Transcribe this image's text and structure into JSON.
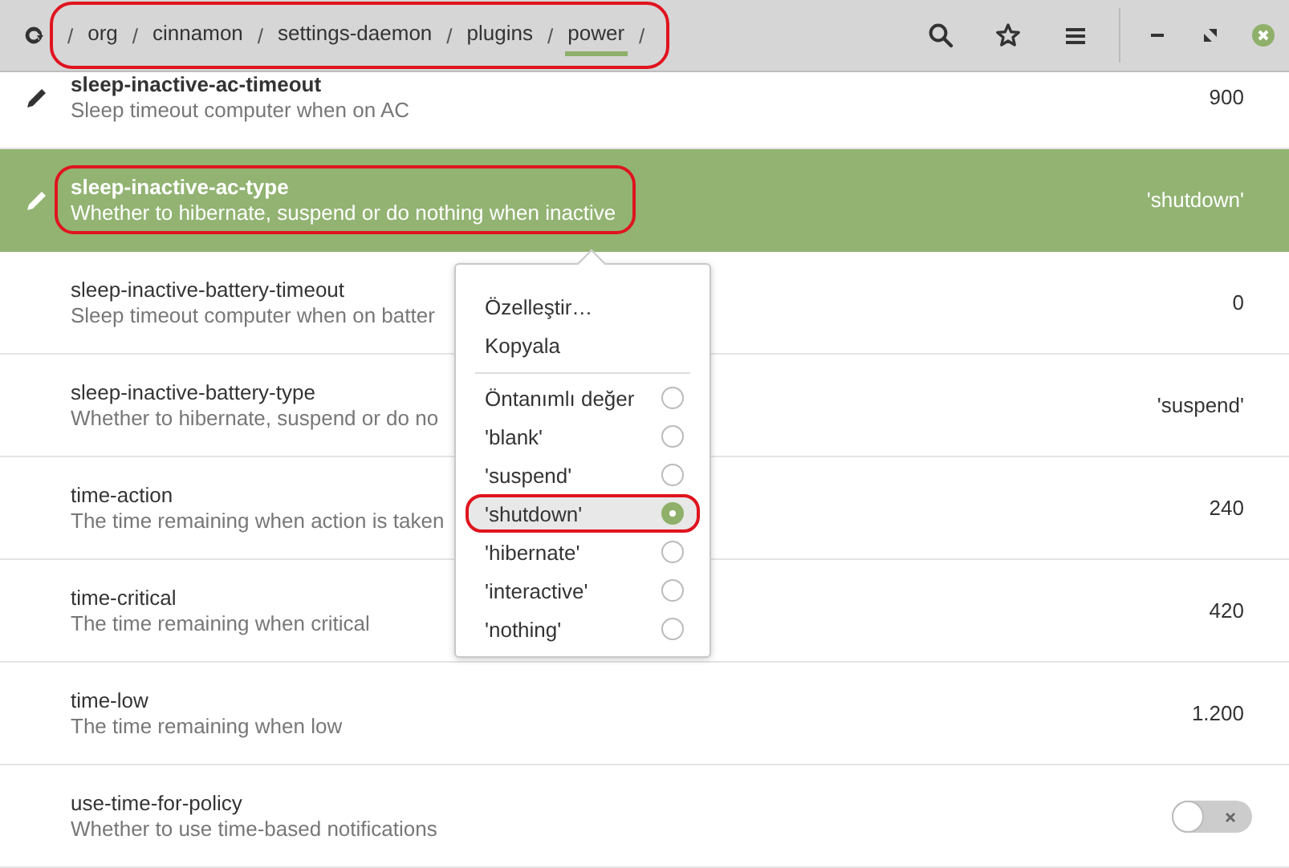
{
  "header": {
    "separator": "/",
    "path": [
      {
        "label": "org",
        "selected": false
      },
      {
        "label": "cinnamon",
        "selected": false
      },
      {
        "label": "settings-daemon",
        "selected": false
      },
      {
        "label": "plugins",
        "selected": false
      },
      {
        "label": "power",
        "selected": true
      }
    ],
    "annotated": true
  },
  "rows": [
    {
      "kind": "value",
      "name": "sleep-inactive-ac-timeout",
      "description": "Sleep timeout computer when on AC",
      "value": "900",
      "modified": true,
      "selected": false,
      "annotated": false
    },
    {
      "kind": "value",
      "name": "sleep-inactive-ac-type",
      "description": "Whether to hibernate, suspend or do nothing when inactive",
      "value": "'shutdown'",
      "modified": true,
      "selected": true,
      "annotated": true
    },
    {
      "kind": "value",
      "name": "sleep-inactive-battery-timeout",
      "description": "Sleep timeout computer when on batter",
      "value": "0",
      "modified": false,
      "selected": false,
      "annotated": false
    },
    {
      "kind": "value",
      "name": "sleep-inactive-battery-type",
      "description": "Whether to hibernate, suspend or do no",
      "value": "'suspend'",
      "modified": false,
      "selected": false,
      "annotated": false
    },
    {
      "kind": "value",
      "name": "time-action",
      "description": "The time remaining when action is taken",
      "value": "240",
      "modified": false,
      "selected": false,
      "annotated": false
    },
    {
      "kind": "value",
      "name": "time-critical",
      "description": "The time remaining when critical",
      "value": "420",
      "modified": false,
      "selected": false,
      "annotated": false
    },
    {
      "kind": "value",
      "name": "time-low",
      "description": "The time remaining when low",
      "value": "1.200",
      "modified": false,
      "selected": false,
      "annotated": false
    },
    {
      "kind": "switch",
      "name": "use-time-for-policy",
      "description": "Whether to use time-based notifications",
      "on": false,
      "modified": false,
      "selected": false,
      "annotated": false
    }
  ],
  "popover": {
    "actions": [
      "Özelleştir…",
      "Kopyala"
    ],
    "options": [
      {
        "label": "Öntanımlı değer",
        "selected": false,
        "annotated": false
      },
      {
        "label": "'blank'",
        "selected": false,
        "annotated": false
      },
      {
        "label": "'suspend'",
        "selected": false,
        "annotated": false
      },
      {
        "label": "'shutdown'",
        "selected": true,
        "annotated": true
      },
      {
        "label": "'hibernate'",
        "selected": false,
        "annotated": false
      },
      {
        "label": "'interactive'",
        "selected": false,
        "annotated": false
      },
      {
        "label": "'nothing'",
        "selected": false,
        "annotated": false
      }
    ]
  }
}
